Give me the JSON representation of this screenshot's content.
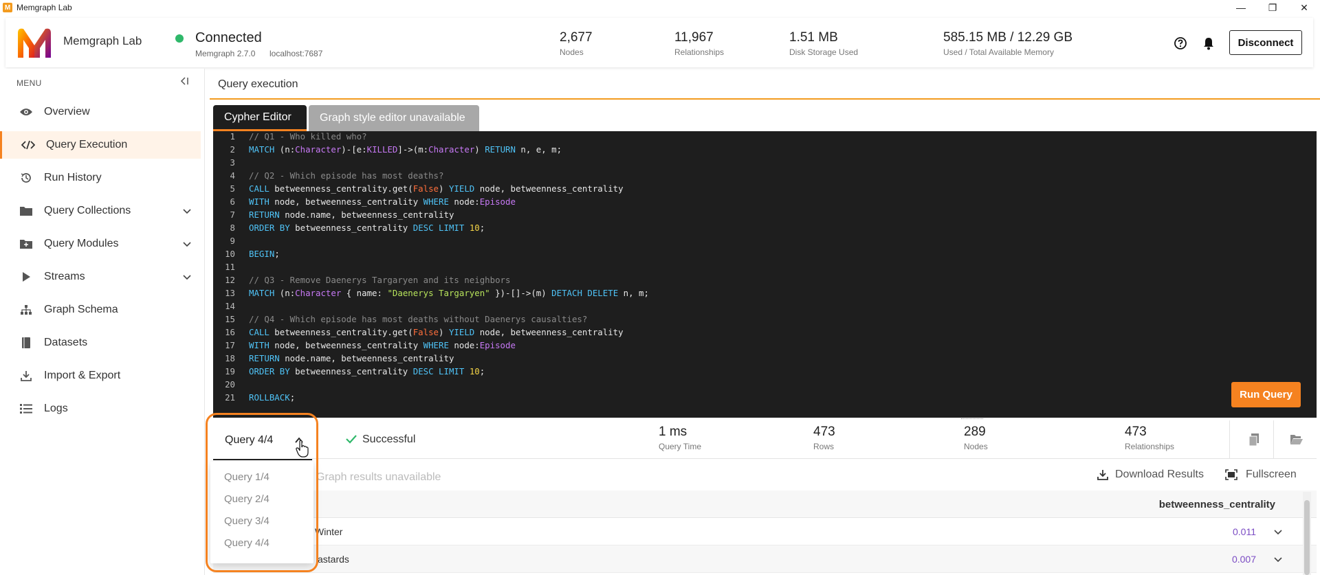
{
  "window": {
    "title": "Memgraph Lab"
  },
  "header": {
    "app_name": "Memgraph Lab",
    "status": "Connected",
    "version": "Memgraph 2.7.0",
    "host": "localhost:7687",
    "stats": [
      {
        "value": "2,677",
        "label": "Nodes"
      },
      {
        "value": "11,967",
        "label": "Relationships"
      },
      {
        "value": "1.51 MB",
        "label": "Disk Storage Used"
      },
      {
        "value": "585.15 MB / 12.29 GB",
        "label": "Used / Total Available Memory"
      }
    ],
    "disconnect_label": "Disconnect"
  },
  "sidebar": {
    "menu_label": "MENU",
    "items": [
      {
        "label": "Overview",
        "icon": "eye-icon"
      },
      {
        "label": "Query Execution",
        "icon": "code-icon",
        "active": true
      },
      {
        "label": "Run History",
        "icon": "history-icon"
      },
      {
        "label": "Query Collections",
        "icon": "folder-icon"
      },
      {
        "label": "Query Modules",
        "icon": "module-folder-icon"
      },
      {
        "label": "Streams",
        "icon": "play-icon"
      },
      {
        "label": "Graph Schema",
        "icon": "schema-icon"
      },
      {
        "label": "Datasets",
        "icon": "dataset-icon"
      },
      {
        "label": "Import & Export",
        "icon": "download-icon"
      },
      {
        "label": "Logs",
        "icon": "list-icon"
      }
    ]
  },
  "main": {
    "page_title": "Query execution",
    "tabs": [
      {
        "label": "Cypher Editor"
      },
      {
        "label": "Graph style editor unavailable"
      }
    ],
    "run_label": "Run Query"
  },
  "summary": {
    "query_selected": "Query 4/4",
    "status": "Successful",
    "stats": [
      {
        "value": "1 ms",
        "label": "Query Time"
      },
      {
        "value": "473",
        "label": "Rows"
      },
      {
        "value": "289",
        "label": "Nodes"
      },
      {
        "value": "473",
        "label": "Relationships"
      }
    ]
  },
  "query_menu": {
    "options": [
      "Query 1/4",
      "Query 2/4",
      "Query 3/4",
      "Query 4/4"
    ]
  },
  "results": {
    "graph_unavailable": "Graph results unavailable",
    "download_label": "Download Results",
    "fullscreen_label": "Fullscreen",
    "column": "betweenness_centrality",
    "rows": [
      {
        "name": "Winter",
        "value": "0.011"
      },
      {
        "name": "astards",
        "value": "0.007"
      }
    ]
  },
  "colors": {
    "accent": "#f58220",
    "connected": "#2fb86a",
    "editor_bg": "#1e1e1e",
    "value_purple": "#7b4cc4"
  }
}
